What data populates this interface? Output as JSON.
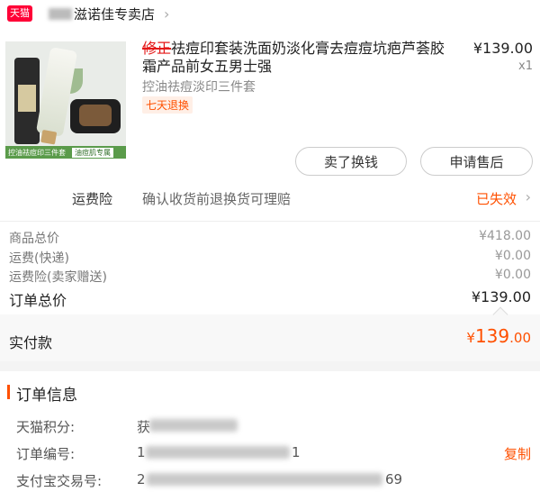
{
  "header": {
    "logo_text": "天猫",
    "shop_name": "滋诺佳专卖店"
  },
  "product": {
    "title_struck": "修正",
    "title": "祛痘印套装洗面奶淡化膏去痘痘坑疤芦荟胶霜产品前女五男士强",
    "price": "¥139.00",
    "quantity": "x1",
    "spec": "控油祛痘淡印三件套",
    "tag": "七天退换",
    "image_banner_1": "控油祛痘印三件套",
    "image_banner_2": "油痘肌专属",
    "buttons": {
      "sell": "卖了换钱",
      "after_sale": "申请售后"
    }
  },
  "insurance": {
    "title": "运费险",
    "description": "确认收货前退换货可理赔",
    "status": "已失效"
  },
  "summary": {
    "items_label": "商品总价",
    "items_value": "¥418.00",
    "shipping_label": "运费(快递)",
    "shipping_value": "¥0.00",
    "insurance_label": "运费险(卖家赠送)",
    "insurance_value": "¥0.00",
    "order_total_label": "订单总价",
    "order_total_value": "¥139.00",
    "paid_label": "实付款",
    "paid_symbol": "¥",
    "paid_int": "139",
    "paid_dec": ".00"
  },
  "order_info": {
    "title": "订单信息",
    "points_label": "天猫积分:",
    "points_value_prefix": "获",
    "order_no_label": "订单编号:",
    "order_no_prefix": "1",
    "order_no_suffix": "1",
    "copy_label": "复制",
    "alipay_label": "支付宝交易号:",
    "alipay_prefix": "2",
    "alipay_suffix": "69"
  },
  "colors": {
    "accent": "#ff5000",
    "tmall_red": "#ff0036"
  }
}
